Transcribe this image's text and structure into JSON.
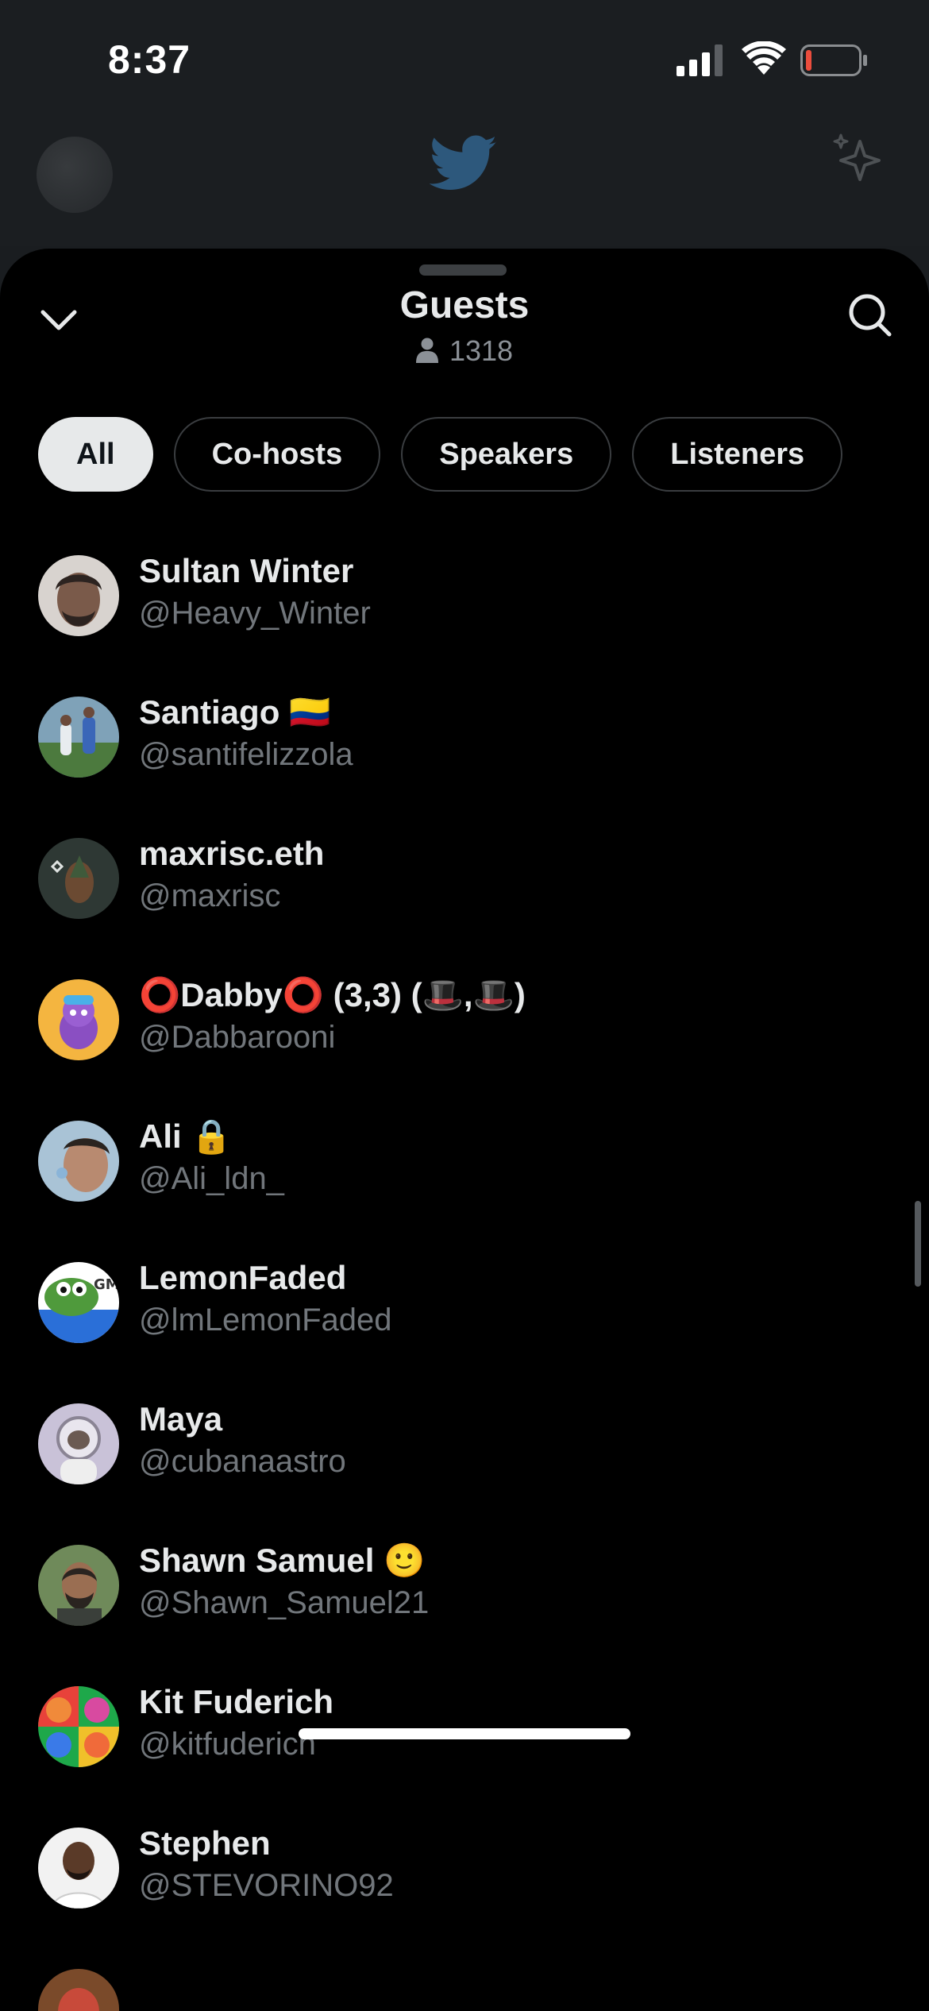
{
  "status_bar": {
    "time": "8:37",
    "icons": [
      "signal-icon",
      "wifi-icon",
      "battery-low-icon"
    ],
    "battery_color": "#eb4d3d"
  },
  "background_header": {
    "icons": [
      "profile-avatar",
      "twitter-bird-icon",
      "sparkle-icon"
    ]
  },
  "sheet": {
    "title": "Guests",
    "count": "1318",
    "icons": [
      "chevron-down-icon",
      "search-icon",
      "person-icon"
    ]
  },
  "filters": [
    {
      "label": "All",
      "active": true
    },
    {
      "label": "Co-hosts",
      "active": false
    },
    {
      "label": "Speakers",
      "active": false
    },
    {
      "label": "Listeners",
      "active": false
    }
  ],
  "guests": [
    {
      "name": "Sultan Winter",
      "handle": "@Heavy_Winter"
    },
    {
      "name": "Santiago 🇨🇴",
      "handle": "@santifelizzola"
    },
    {
      "name": "maxrisc.eth",
      "handle": "@maxrisc"
    },
    {
      "name": "⭕Dabby⭕ (3,3) (🎩,🎩)",
      "handle": "@Dabbarooni"
    },
    {
      "name": "Ali 🔒",
      "handle": "@Ali_ldn_"
    },
    {
      "name": "LemonFaded",
      "handle": "@lmLemonFaded"
    },
    {
      "name": "Maya",
      "handle": "@cubanaastro"
    },
    {
      "name": "Shawn Samuel 🙂",
      "handle": "@Shawn_Samuel21"
    },
    {
      "name": "Kit Fuderich",
      "handle": "@kitfuderich"
    },
    {
      "name": "Stephen",
      "handle": "@STEVORINO92"
    }
  ],
  "colors": {
    "background": "#000000",
    "text_primary": "#e7e9ea",
    "text_secondary": "#71767b",
    "chip_active_bg": "#e7e9ea",
    "chip_border": "#3a3d40"
  }
}
